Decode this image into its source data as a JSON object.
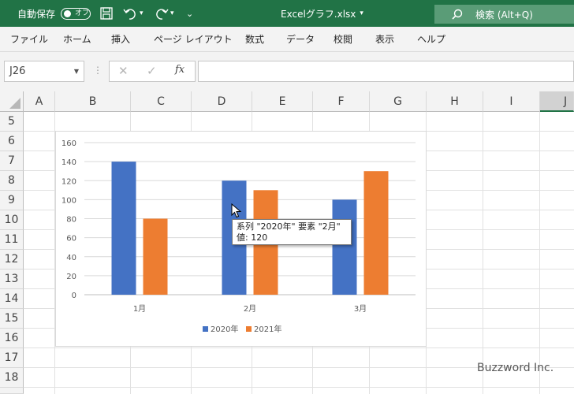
{
  "titlebar": {
    "autosave_label": "自動保存",
    "toggle_label": "オフ",
    "filename": "Excelグラフ.xlsx",
    "search_label": "検索 (Alt+Q)"
  },
  "menu": [
    "ファイル",
    "ホーム",
    "挿入",
    "ページ レイアウト",
    "数式",
    "データ",
    "校閲",
    "表示",
    "ヘルプ"
  ],
  "formula_bar": {
    "cell_ref": "J26",
    "fx_label": "fx"
  },
  "columns": [
    "A",
    "B",
    "C",
    "D",
    "E",
    "F",
    "G",
    "H",
    "I",
    "J"
  ],
  "rows": [
    "5",
    "6",
    "7",
    "8",
    "9",
    "10",
    "11",
    "12",
    "13",
    "14",
    "15",
    "16",
    "17",
    "18",
    "19"
  ],
  "chart_data": {
    "type": "bar",
    "categories": [
      "1月",
      "2月",
      "3月"
    ],
    "series": [
      {
        "name": "2020年",
        "values": [
          140,
          120,
          100
        ],
        "color": "#4472c4"
      },
      {
        "name": "2021年",
        "values": [
          80,
          110,
          130
        ],
        "color": "#ed7d31"
      }
    ],
    "yticks": [
      "0",
      "20",
      "40",
      "60",
      "80",
      "100",
      "120",
      "140",
      "160"
    ],
    "ylim": [
      0,
      160
    ],
    "grid": true,
    "legend": "bottom"
  },
  "tooltip": {
    "line1": "系列 \"2020年\" 要素 \"2月\"",
    "line2": "値: 120"
  },
  "watermark": "Buzzword Inc."
}
